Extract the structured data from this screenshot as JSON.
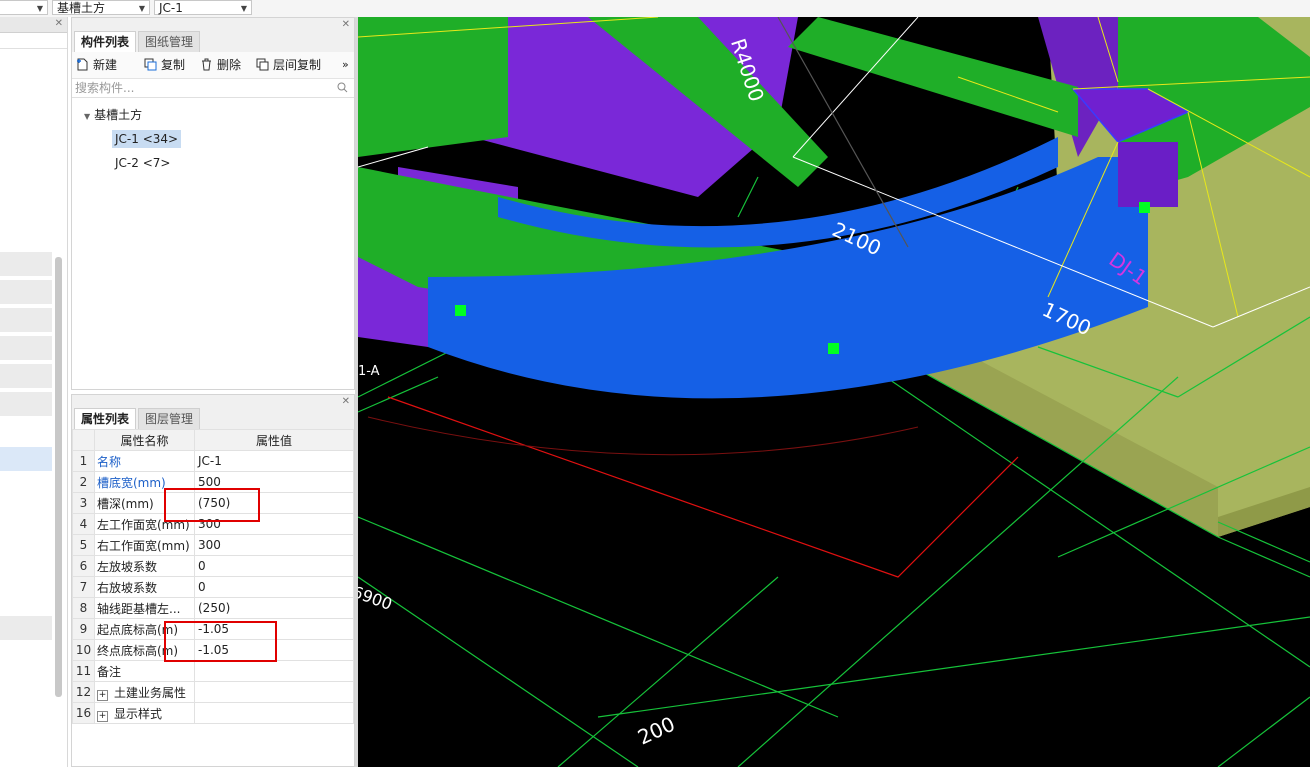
{
  "top_bar": {
    "combo1_value": "",
    "combo2_value": "基槽土方",
    "combo3_value": "JC-1"
  },
  "component_panel": {
    "tabs": [
      "构件列表",
      "图纸管理"
    ],
    "toolbar": {
      "new": "新建",
      "copy": "复制",
      "delete": "删除",
      "floor_copy": "层间复制",
      "more": "»"
    },
    "search_placeholder": "搜索构件...",
    "tree": {
      "group": "基槽土方",
      "items": [
        {
          "label": "JC-1 <34>",
          "selected": true
        },
        {
          "label": "JC-2 <7>",
          "selected": false
        }
      ]
    }
  },
  "properties_panel": {
    "tabs": [
      "属性列表",
      "图层管理"
    ],
    "header": {
      "name": "属性名称",
      "value": "属性值"
    },
    "rows": [
      {
        "num": "1",
        "name": "名称",
        "value": "JC-1",
        "blue": true
      },
      {
        "num": "2",
        "name": "槽底宽(mm)",
        "value": "500",
        "blue": true
      },
      {
        "num": "3",
        "name": "槽深(mm)",
        "value": "(750)",
        "blue": false
      },
      {
        "num": "4",
        "name": "左工作面宽(mm)",
        "value": "300",
        "blue": false
      },
      {
        "num": "5",
        "name": "右工作面宽(mm)",
        "value": "300",
        "blue": false
      },
      {
        "num": "6",
        "name": "左放坡系数",
        "value": "0",
        "blue": false
      },
      {
        "num": "7",
        "name": "右放坡系数",
        "value": "0",
        "blue": false
      },
      {
        "num": "8",
        "name": "轴线距基槽左...",
        "value": "(250)",
        "blue": false
      },
      {
        "num": "9",
        "name": "起点底标高(m)",
        "value": "-1.05",
        "blue": false
      },
      {
        "num": "10",
        "name": "终点底标高(m)",
        "value": "-1.05",
        "blue": false
      },
      {
        "num": "11",
        "name": "备注",
        "value": "",
        "blue": false
      },
      {
        "num": "12",
        "name": "土建业务属性",
        "value": "",
        "blue": false,
        "expandable": true
      },
      {
        "num": "16",
        "name": "显示样式",
        "value": "",
        "blue": false,
        "expandable": true
      }
    ]
  },
  "viewport": {
    "labels": {
      "radius": "R4000",
      "dim_2100": "2100",
      "dim_1700": "1700",
      "dj": "DJ-1",
      "axis_a": "1-A",
      "dim_6900": "6900",
      "dim_200": "200"
    },
    "colors": {
      "background": "#000000",
      "green_beam": "#1fae28",
      "purple_beam": "#7a28d8",
      "blue_trench": "#1560e6",
      "foundation": "#a8b55e",
      "grid_green": "#16c23a",
      "red_axis": "#e01010",
      "yellow_lines": "#e8e81a",
      "dj_label": "#d436e0"
    }
  }
}
